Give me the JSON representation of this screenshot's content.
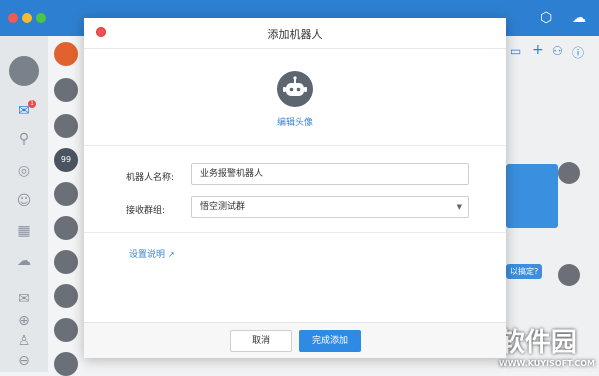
{
  "dialog": {
    "title": "添加机器人",
    "edit_avatar": "编辑头像",
    "name_label": "机器人名称:",
    "name_value": "业务报警机器人",
    "group_label": "接收群组:",
    "group_value": "悟空测试群",
    "help_link": "设置说明",
    "cancel": "取消",
    "confirm": "完成添加"
  },
  "background": {
    "badge_count": "1",
    "chat_avatar_text": "99",
    "bubble_text": "以搞定?",
    "watermark": "软件园",
    "watermark_url": "WWW.KUYISOFT.COM"
  },
  "colors": {
    "topbar": "#2d7fd1",
    "accent": "#2f8ae3",
    "link": "#3b86d6"
  }
}
